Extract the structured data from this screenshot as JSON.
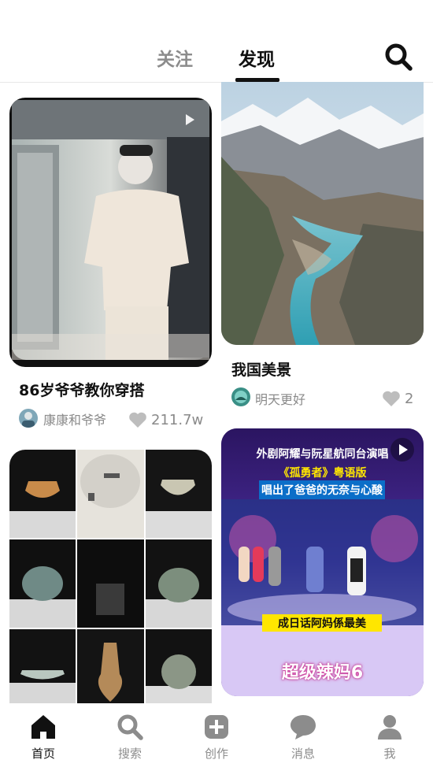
{
  "header": {
    "tabs": [
      {
        "label": "关注",
        "active": false
      },
      {
        "label": "发现",
        "active": true
      }
    ],
    "search_icon": "search-icon"
  },
  "feed": [
    {
      "title": "86岁爷爷教你穿搭",
      "author": "康康和爷爷",
      "likes": "211.7w",
      "type": "video"
    },
    {
      "title": "我国美景",
      "author": "明天更好",
      "likes": "2",
      "type": "image"
    },
    {
      "title": "",
      "author": "",
      "likes": "",
      "type": "image"
    },
    {
      "title": "",
      "author": "",
      "likes": "",
      "type": "video",
      "overlay": {
        "headline": "外剧阿耀与阮星航同台演唱",
        "subtitle1": "《孤勇者》粤语版",
        "subtitle2": "唱出了爸爸的无奈与心酸",
        "caption": "成日话阿妈係最美",
        "show_logo": "超级辣妈6"
      }
    }
  ],
  "bottom_nav": [
    {
      "label": "首页",
      "icon": "home-icon",
      "active": true
    },
    {
      "label": "搜索",
      "icon": "search-icon",
      "active": false
    },
    {
      "label": "创作",
      "icon": "plus-icon",
      "active": false
    },
    {
      "label": "消息",
      "icon": "message-icon",
      "active": false
    },
    {
      "label": "我",
      "icon": "person-icon",
      "active": false
    }
  ],
  "colors": {
    "active": "#111111",
    "inactive": "#8c8c8c"
  }
}
